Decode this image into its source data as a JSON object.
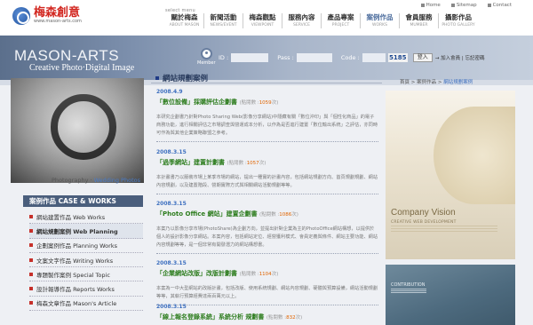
{
  "header": {
    "logo_cn": "梅森創意",
    "logo_url": "www.mason-arts.com",
    "util_links": [
      "Home",
      "Sitemap",
      "Contact"
    ],
    "select_menu": "select menu",
    "nav": [
      {
        "cn": "關於梅森",
        "en": "ABOUT MASON"
      },
      {
        "cn": "新聞活動",
        "en": "NEWS/EVENT"
      },
      {
        "cn": "梅森觀點",
        "en": "VIEWPOINT"
      },
      {
        "cn": "服務內容",
        "en": "SERVICE"
      },
      {
        "cn": "產品專案",
        "en": "PROJECT"
      },
      {
        "cn": "案例作品",
        "en": "WORKS"
      },
      {
        "cn": "會員服務",
        "en": "MUMBER"
      },
      {
        "cn": "攝影作品",
        "en": "PHOTO GALLERY"
      }
    ]
  },
  "banner": {
    "brand_line1": "MASON-ARTS",
    "brand_line2": "Creative Photo‧Digital Image",
    "member_label": "Member",
    "login": {
      "id_label": "ID :",
      "pass_label": "Pass :",
      "code_label": "Code :",
      "captcha": "5185",
      "button": "登入",
      "links": "→ 加入會員 | 忘記密碼"
    }
  },
  "left": {
    "photo_caption_a": "Photography ‧",
    "photo_caption_b": "Wedding Photos",
    "menu_title": "案例作品 CASE & WORKS",
    "menu": [
      "網站建置作品 Web Works",
      "網站規劃案例 Web Planning",
      "企劃案例作品 Planning Works",
      "文案文字作品 Writing Works",
      "專題製作案例 Special Topic",
      "設計報導作品 Reports Works",
      "梅森文章作品 Mason's Article"
    ]
  },
  "content": {
    "section_title": "網站規劃案例",
    "articles": [
      {
        "date": "2008.4.9",
        "title": "「數位設備」採購評估企劃書",
        "hits_prefix": "(點閱數 :",
        "hits": "1059",
        "hits_suffix": "次)",
        "desc": "本研究企劃書乃針對Photo Sharing Web(影像分享網站)中隱藏有關「數位沖印」與「個性化商品」的電子商務功能，進行相關評估之市場調查與營運成本分析，以作為是否進行建置「數位輸出系統」之評估，亦同時可作為與其他企業策略聯盟之參考。"
      },
      {
        "date": "2008.3.15",
        "title": "「過季網站」建置計劃書",
        "hits_prefix": "(點閱數 :",
        "hits": "1057",
        "hits_suffix": "次)",
        "desc": "本計畫書乃以服裝市場上某季市場的網站，提出一種實的計畫內容，包括網站規劃方向、首頁規劃規劃、網站內容規劃，以及建置階段、營期實際方式與相關網站活動規劃等等。"
      },
      {
        "date": "2008.3.15",
        "title": "「Photo Office 網站」建置企劃書",
        "hits_prefix": "(點閱數 :",
        "hits": "1086",
        "hits_suffix": "次)",
        "desc": "本案乃以影像分享市場(PhotoShare)為企劃方向，並提出針對企業為主的PhotoOffice網站構想，以提供於個人的設計影像分享網站。本案內容，包括網站定位、經營獲利模式、會員定義與條件、網站主要功能、網站內容規劃等等，是一個非常有開發潛力的網站構想書。"
      },
      {
        "date": "2008.3.15",
        "title": "「企業網站改版」改版計劃書",
        "hits_prefix": "(點閱數 :",
        "hits": "1104",
        "hits_suffix": "次)",
        "desc": "本案為一中大型網站的改版計畫，包括改版、使用系統規劃、網站內容規劃、硬體與預算設備，網站活動規劃等等，其執行預算經費達兩百萬元以上。"
      },
      {
        "date": "2008.3.15",
        "title": "「線上報名登錄系統」系統分析 規劃書",
        "hits_prefix": "(點閱數 :",
        "hits": "832",
        "hits_suffix": "次)",
        "desc": ""
      }
    ]
  },
  "right": {
    "breadcrumb_prefix": "首頁 > 案例作品 > ",
    "breadcrumb_current": "網站規劃案例",
    "img1_title": "Company Vision",
    "img1_sub": "CREATIVE WEB DEVELOPMENT",
    "img2_title": "CONTRIBUTION"
  },
  "colors": {
    "accent": "#4a5e7c",
    "title_green": "#2e7d1f",
    "date_blue": "#3d6fbf",
    "hits_orange": "#e06400",
    "bullet_red": "#c6302a"
  }
}
